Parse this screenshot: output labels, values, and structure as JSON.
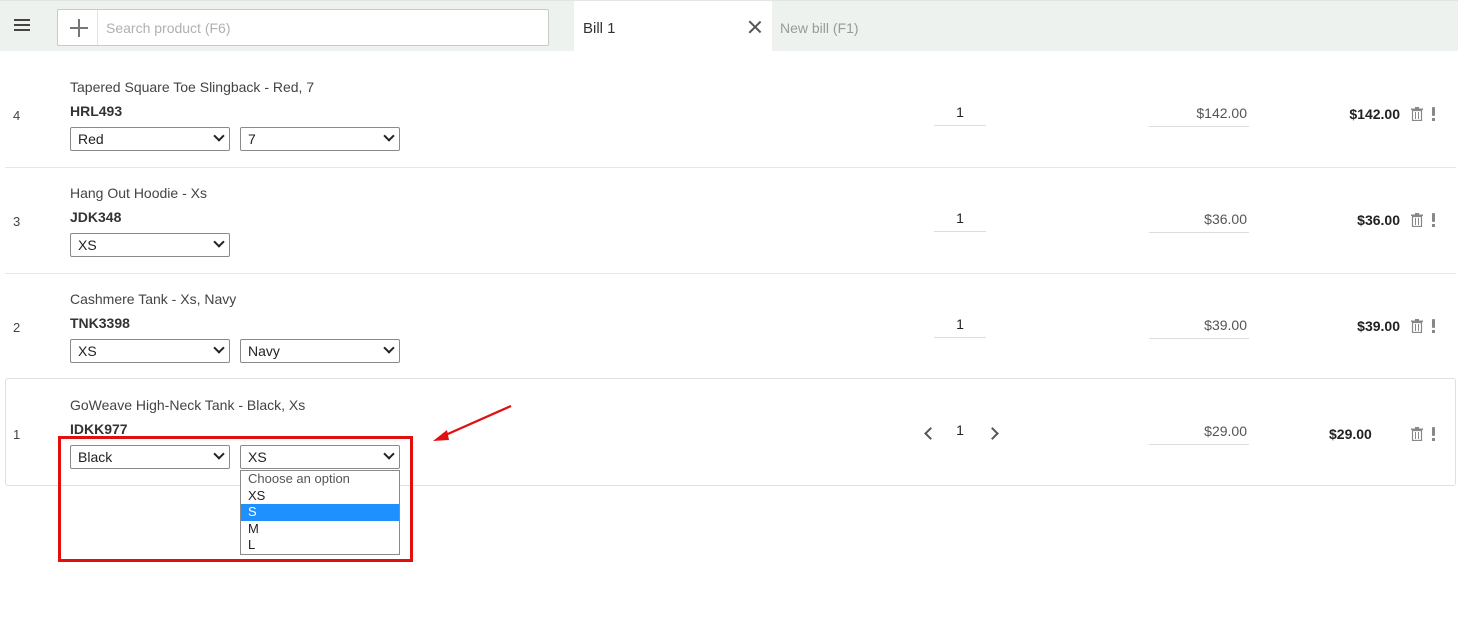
{
  "header": {
    "search_placeholder": "Search product (F6)",
    "active_tab_label": "Bill 1",
    "new_tab_label": "New bill (F1)"
  },
  "rows": [
    {
      "index": "4",
      "name": "Tapered Square Toe Slingback - Red, 7",
      "sku": "HRL493",
      "option1": "Red",
      "option2": "7",
      "qty": "1",
      "price": "$142.00",
      "total": "$142.00"
    },
    {
      "index": "3",
      "name": "Hang Out Hoodie - Xs",
      "sku": "JDK348",
      "option1": "XS",
      "qty": "1",
      "price": "$36.00",
      "total": "$36.00"
    },
    {
      "index": "2",
      "name": "Cashmere Tank - Xs, Navy",
      "sku": "TNK3398",
      "option1": "XS",
      "option2": "Navy",
      "qty": "1",
      "price": "$39.00",
      "total": "$39.00"
    },
    {
      "index": "1",
      "name": "GoWeave High-Neck Tank - Black, Xs",
      "sku": "IDKK977",
      "option1": "Black",
      "option2": "XS",
      "qty": "1",
      "price": "$29.00",
      "total": "$29.00"
    }
  ],
  "dropdown": {
    "options": [
      "Choose an option",
      "XS",
      "S",
      "M",
      "L"
    ],
    "highlighted": "S"
  },
  "colors": {
    "topbar_bg": "#eef2ee",
    "highlight": "#1e90ff",
    "annotation": "#e01010"
  },
  "icons": {
    "menu": "hamburger-menu-icon",
    "add": "plus-icon",
    "close": "close-icon",
    "delete": "trash-icon",
    "alert": "exclamation-icon",
    "decrement": "chevron-left-icon",
    "increment": "chevron-right-icon"
  }
}
